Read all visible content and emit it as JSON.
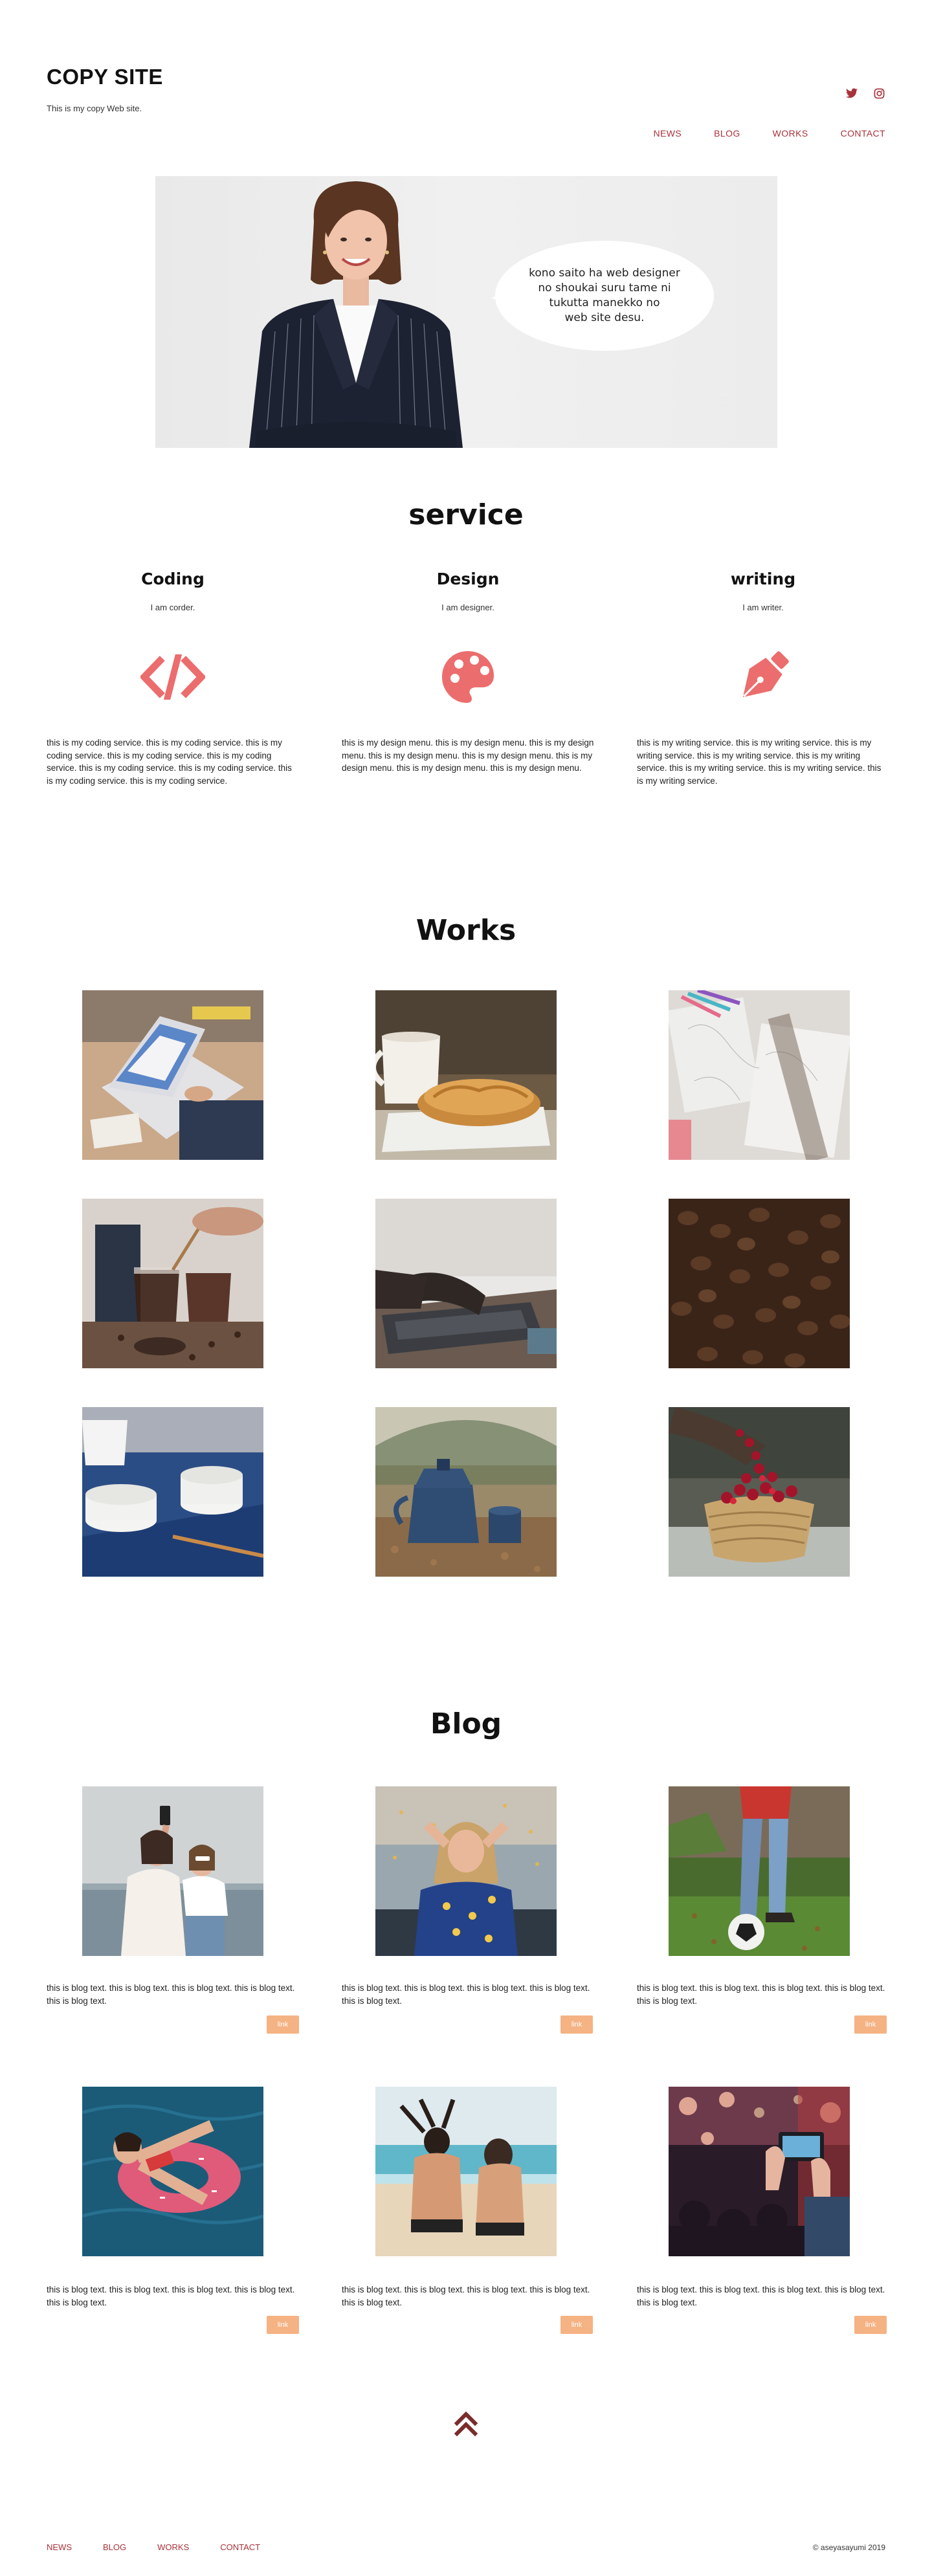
{
  "header": {
    "site_title": "COPY SITE",
    "site_subtitle": "This is my copy Web site.",
    "social": [
      "twitter-icon",
      "instagram-icon"
    ],
    "nav": [
      "NEWS",
      "BLOG",
      "WORKS",
      "CONTACT"
    ]
  },
  "hero": {
    "bubble_lines": [
      "kono saito ha web designer",
      "no shoukai  suru tame ni",
      "tukutta manekko no",
      "web site desu."
    ]
  },
  "service": {
    "title": "service",
    "items": [
      {
        "name": "Coding",
        "sub": "I am corder.",
        "icon": "code-icon",
        "text": "this is my coding service. this is my coding service. this is my coding service. this is my coding service. this is my coding service. this is my coding service. this is my coding service. this is my coding service. this is my coding service."
      },
      {
        "name": "Design",
        "sub": "I am designer.",
        "icon": "palette-icon",
        "text": "this is my design menu. this is my design menu. this is my design menu. this is my design menu. this is my design menu. this is my design menu. this is my design menu. this is my design menu."
      },
      {
        "name": "writing",
        "sub": "I am writer.",
        "icon": "pen-nib-icon",
        "text": "this is my writing service. this is my writing service. this is my writing service. this is my writing service. this is my writing service. this is my writing service. this is my writing service. this is my writing service."
      }
    ]
  },
  "works": {
    "title": "Works"
  },
  "blog": {
    "title": "Blog",
    "posts": [
      {
        "text": "this is blog text. this is blog text. this is blog text. this is blog text. this is blog text.",
        "link": "link"
      },
      {
        "text": "this is blog text. this is blog text. this is blog text. this is blog text. this is blog text.",
        "link": "link"
      },
      {
        "text": "this is blog text. this is blog text. this is blog text. this is blog text. this is blog text.",
        "link": "link"
      },
      {
        "text": "this is blog text. this is blog text. this is blog text. this is blog text. this is blog text.",
        "link": "link"
      },
      {
        "text": "this is blog text. this is blog text. this is blog text. this is blog text. this is blog text.",
        "link": "link"
      },
      {
        "text": "this is blog text. this is blog text. this is blog text. this is blog text. this is blog text.",
        "link": "link"
      }
    ]
  },
  "footer": {
    "nav": [
      "NEWS",
      "BLOG",
      "WORKS",
      "CONTACT"
    ],
    "copyright": "© aseyasayumi 2019"
  },
  "colors": {
    "accent": "#a8323a",
    "icon": "#ec6d6d",
    "link_button": "#f5b283"
  }
}
